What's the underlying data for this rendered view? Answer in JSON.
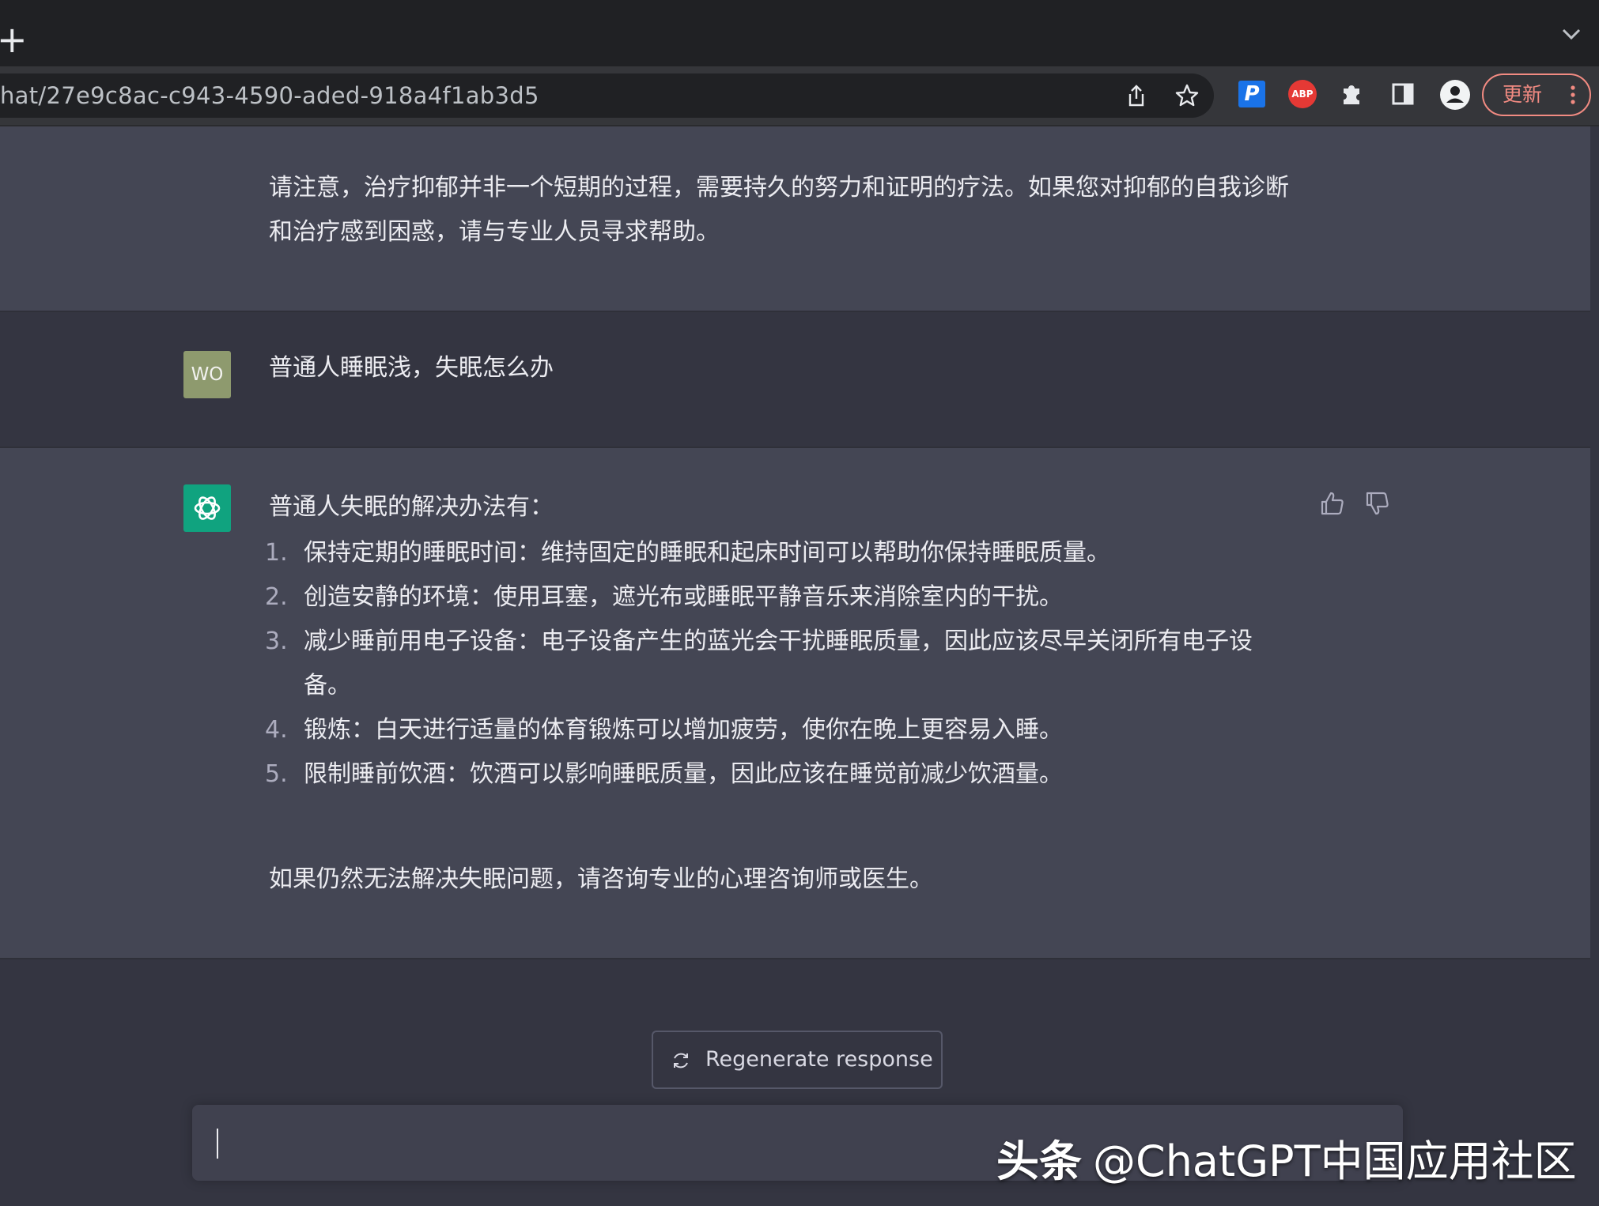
{
  "browser": {
    "new_tab_glyph": "+",
    "url": "hat/27e9c8ac-c943-4590-aded-918a4f1ab3d5",
    "extensions": {
      "p_label": "P",
      "abp_label": "ABP"
    },
    "update_label": "更新"
  },
  "conversation": {
    "prev_assistant_tail": "请注意，治疗抑郁并非一个短期的过程，需要持久的努力和证明的疗法。如果您对抑郁的自我诊断和治疗感到困惑，请与专业人员寻求帮助。",
    "user": {
      "avatar_initials": "WO",
      "message": "普通人睡眠浅，失眠怎么办"
    },
    "assistant": {
      "intro": "普通人失眠的解决办法有：",
      "items": [
        {
          "num": "1.",
          "text": "保持定期的睡眠时间：维持固定的睡眠和起床时间可以帮助你保持睡眠质量。"
        },
        {
          "num": "2.",
          "text": "创造安静的环境：使用耳塞，遮光布或睡眠平静音乐来消除室内的干扰。"
        },
        {
          "num": "3.",
          "text": "减少睡前用电子设备：电子设备产生的蓝光会干扰睡眠质量，因此应该尽早关闭所有电子设备。"
        },
        {
          "num": "4.",
          "text": "锻炼：白天进行适量的体育锻炼可以增加疲劳，使你在晚上更容易入睡。"
        },
        {
          "num": "5.",
          "text": "限制睡前饮酒：饮酒可以影响睡眠质量，因此应该在睡觉前减少饮酒量。"
        }
      ],
      "outro": "如果仍然无法解决失眠问题，请咨询专业的心理咨询师或医生。"
    }
  },
  "regenerate_label": "Regenerate response",
  "composer": {
    "value": ""
  },
  "watermark": {
    "brand": "头条",
    "handle": "@ChatGPT中国应用社区"
  },
  "colors": {
    "assistant_bg": "#444654",
    "user_bg": "#343541",
    "gpt_avatar": "#10a37f",
    "user_avatar": "#8e9a6e",
    "update_accent": "#f28b82"
  }
}
